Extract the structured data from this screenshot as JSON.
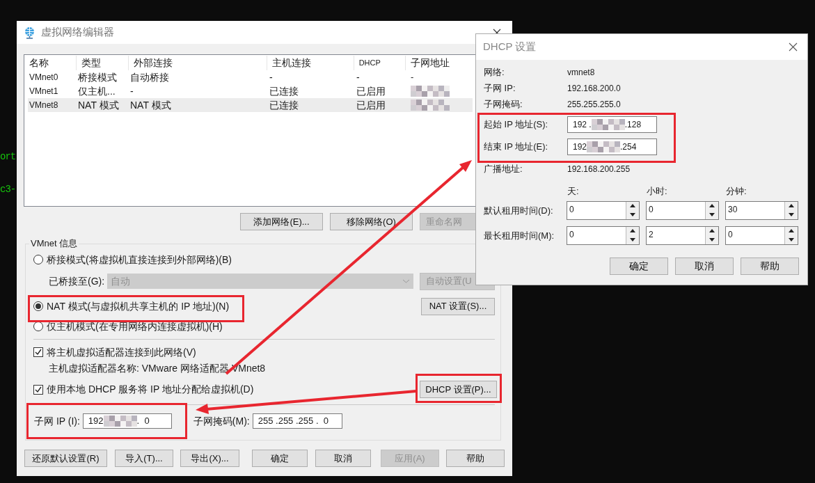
{
  "terminal": {
    "lines": [
      "ort",
      "c3-"
    ]
  },
  "main_window": {
    "title": "虚拟网络编辑器",
    "table": {
      "columns": [
        "名称",
        "类型",
        "外部连接",
        "主机连接",
        "DHCP",
        "子网地址"
      ],
      "rows": [
        {
          "name": "VMnet0",
          "type": "桥接模式",
          "external": "自动桥接",
          "host": "-",
          "dhcp": "-",
          "subnet": "-",
          "subnet_redacted": false,
          "selected": false
        },
        {
          "name": "VMnet1",
          "type": "仅主机...",
          "external": "-",
          "host": "已连接",
          "dhcp": "已启用",
          "subnet_redacted": true,
          "selected": false
        },
        {
          "name": "VMnet8",
          "type": "NAT 模式",
          "external": "NAT 模式",
          "host": "已连接",
          "dhcp": "已启用",
          "subnet_redacted": true,
          "selected": true
        }
      ]
    },
    "list_buttons": [
      {
        "label": "添加网络(E)...",
        "disabled": false
      },
      {
        "label": "移除网络(O)",
        "disabled": false
      },
      {
        "label": "重命名网",
        "disabled": true
      }
    ],
    "group": {
      "title": "VMnet 信息",
      "modes": [
        {
          "label": "桥接模式(将虚拟机直接连接到外部网络)(B)",
          "selected": false
        },
        {
          "label": "NAT 模式(与虚拟机共享主机的 IP 地址)(N)",
          "selected": true
        },
        {
          "label": "仅主机模式(在专用网络内连接虚拟机)(H)",
          "selected": false
        }
      ],
      "bridged_to": {
        "label": "已桥接至(G):",
        "value": "自动",
        "disabled": true
      },
      "auto_button": {
        "label": "自动设置(U",
        "disabled": true
      },
      "nat_button": {
        "label": "NAT 设置(S)...",
        "disabled": false
      },
      "checkboxes": [
        {
          "label": "将主机虚拟适配器连接到此网络(V)",
          "checked": true
        },
        {
          "label": "使用本地 DHCP 服务将 IP 地址分配给虚拟机(D)",
          "checked": true
        }
      ],
      "adapter_name": "主机虚拟适配器名称: VMware 网络适配器 VMnet8",
      "dhcp_button": {
        "label": "DHCP 设置(P)...",
        "disabled": false
      },
      "subnet_ip": {
        "label": "子网 IP (I):",
        "prefix": "192",
        "suffix": ".  0"
      },
      "subnet_mask": {
        "label": "子网掩码(M):",
        "value": "255 .255 .255 .  0"
      }
    },
    "buttons": [
      {
        "label": "还原默认设置(R)",
        "disabled": false
      },
      {
        "label": "导入(T)...",
        "disabled": false
      },
      {
        "label": "导出(X)...",
        "disabled": false
      },
      {
        "label": "确定",
        "disabled": false
      },
      {
        "label": "取消",
        "disabled": false
      },
      {
        "label": "应用(A)",
        "disabled": true
      },
      {
        "label": "帮助",
        "disabled": false
      }
    ]
  },
  "dhcp_dialog": {
    "title": "DHCP 设置",
    "info": [
      {
        "label": "网络:",
        "value": "vmnet8"
      },
      {
        "label": "子网 IP:",
        "value": "192.168.200.0"
      },
      {
        "label": "子网掩码:",
        "value": "255.255.255.0"
      }
    ],
    "start_ip": {
      "label": "起始 IP 地址(S):",
      "prefix": "192 .",
      "suffix": ".128"
    },
    "end_ip": {
      "label": "结束 IP 地址(E):",
      "prefix": "192",
      "suffix": ".254"
    },
    "broadcast": {
      "label": "广播地址:",
      "value": "192.168.200.255"
    },
    "lease_headers": [
      "天:",
      "小时:",
      "分钟:"
    ],
    "leases": [
      {
        "label": "默认租用时间(D):",
        "values": [
          "0",
          "0",
          "30"
        ]
      },
      {
        "label": "最长租用时间(M):",
        "values": [
          "0",
          "2",
          "0"
        ]
      }
    ],
    "buttons": [
      {
        "label": "确定",
        "disabled": false
      },
      {
        "label": "取消",
        "disabled": false
      },
      {
        "label": "帮助",
        "disabled": false
      }
    ]
  }
}
